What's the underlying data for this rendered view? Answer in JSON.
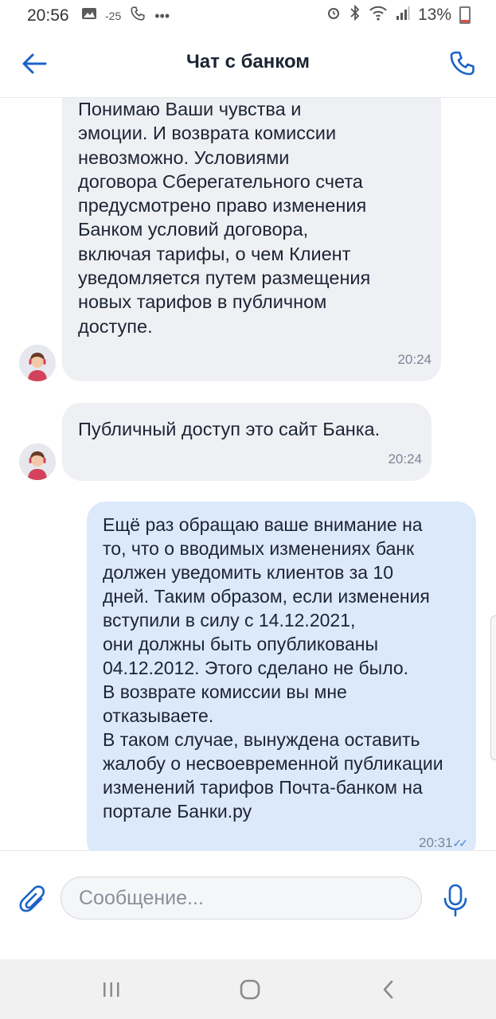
{
  "status_bar": {
    "time": "20:56",
    "temperature": "-25",
    "battery": "13%",
    "icons_left": [
      "image-icon",
      "temperature-icon",
      "call-icon",
      "more-dots-icon"
    ],
    "icons_right": [
      "alarm-icon",
      "bluetooth-icon",
      "wifi-icon",
      "signal-icon",
      "battery-icon"
    ]
  },
  "header": {
    "title": "Чат с банком"
  },
  "messages": [
    {
      "direction": "incoming",
      "text": "Понимаю Ваши чувства и\nэмоции. И возврата комиссии\nневозможно. Условиями\nдоговора Сберегательного счета\nпредусмотрено право изменения\nБанком условий договора,\nвключая тарифы, о чем Клиент\nуведомляется путем размещения\nновых тарифов в публичном\nдоступе.",
      "time": "20:24"
    },
    {
      "direction": "incoming",
      "text": "Публичный доступ это сайт Банка.",
      "time": "20:24"
    },
    {
      "direction": "outgoing",
      "text": "Ещё раз обращаю ваше внимание на\nто, что о вводимых изменениях банк\nдолжен уведомить клиентов за 10\nдней. Таким образом, если изменения\nвступили в силу с 14.12.2021,\nони должны быть опубликованы\n04.12.2012. Этого сделано не было.\nВ возврате комиссии вы мне\nотказываете.\nВ таком случае, вынуждена оставить\nжалобу о несвоевременной публикации\nизменений тарифов Почта-банком на\nпортале Банки.ру",
      "time": "20:31",
      "read_mark": "✓✓"
    }
  ],
  "composer": {
    "placeholder": "Сообщение..."
  },
  "colors": {
    "accent": "#1a63c7",
    "incoming_bubble": "#eff0f4",
    "outgoing_bubble": "#dbe9fb"
  }
}
